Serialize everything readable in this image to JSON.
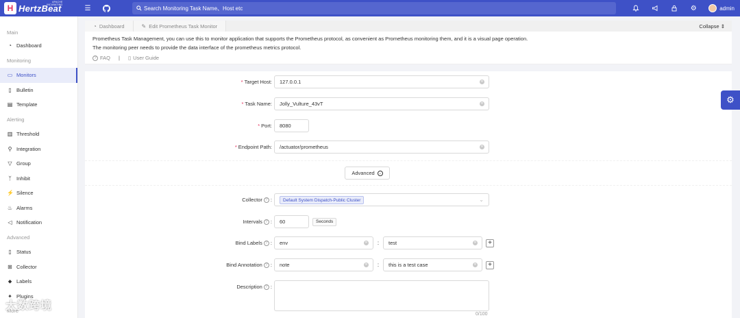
{
  "header": {
    "logo_letter": "H",
    "logo_text": "HertzBeat",
    "logo_sub_top": "APACHE",
    "logo_sub_bottom": "INCUBATING",
    "search_placeholder": "Search Monitoring Task Name、Host etc",
    "user_name": "admin",
    "icons": [
      "menu-icon",
      "github-icon",
      "search-icon",
      "bell-icon",
      "megaphone-icon",
      "lock-icon",
      "gear-icon",
      "user-avatar"
    ],
    "accent_color": "#3e51c7"
  },
  "sidebar": {
    "groups": {
      "main": "Main",
      "monitoring": "Monitoring",
      "alerting": "Alerting",
      "advanced": "Advanced",
      "more": "More"
    },
    "items": {
      "dashboard": "Dashboard",
      "monitors": "Monitors",
      "bulletin": "Bulletin",
      "template": "Template",
      "threshold": "Threshold",
      "integration": "Integration",
      "group": "Group",
      "inhibit": "Inhibit",
      "silence": "Silence",
      "alarms": "Alarms",
      "notification": "Notification",
      "status": "Status",
      "collector": "Collector",
      "labels": "Labels",
      "plugins": "Plugins"
    }
  },
  "tabs": {
    "dashboard": "Dashboard",
    "edit": "Edit Prometheus Task Monitor",
    "collapse": "Collapse"
  },
  "description": {
    "line1": "Prometheus Task Management, you can use this to monitor application that supports the Prometheus protocol, as convenient as Prometheus monitoring them, and it is a visual page operation.",
    "line2": "The monitoring peer needs to provide the data interface of the prometheus metrics protocol.",
    "faq": "FAQ",
    "separator": "|",
    "guide": "User Guide"
  },
  "form": {
    "target_host": {
      "label": "Target Host:",
      "value": "127.0.0.1"
    },
    "task_name": {
      "label": "Task Name:",
      "value": "Jolly_Vulture_43vT"
    },
    "port": {
      "label": "Port:",
      "value": "8080"
    },
    "endpoint_path": {
      "label": "Endpoint Path:",
      "value": "/actuator/prometheus"
    },
    "advanced": "Advanced",
    "collector": {
      "label": "Collector",
      "value": "Default System Dispatch-Public Cluster"
    },
    "intervals": {
      "label": "Intervals",
      "value": "60",
      "unit": "Seconds"
    },
    "bind_labels": {
      "label": "Bind Labels",
      "key": "env",
      "value": "test"
    },
    "bind_annotation": {
      "label": "Bind Annotation",
      "key": "note",
      "value": "this is a test case"
    },
    "description": {
      "label": "Description",
      "value": "",
      "counter": "0/100"
    }
  },
  "watermark": "大数跨境"
}
